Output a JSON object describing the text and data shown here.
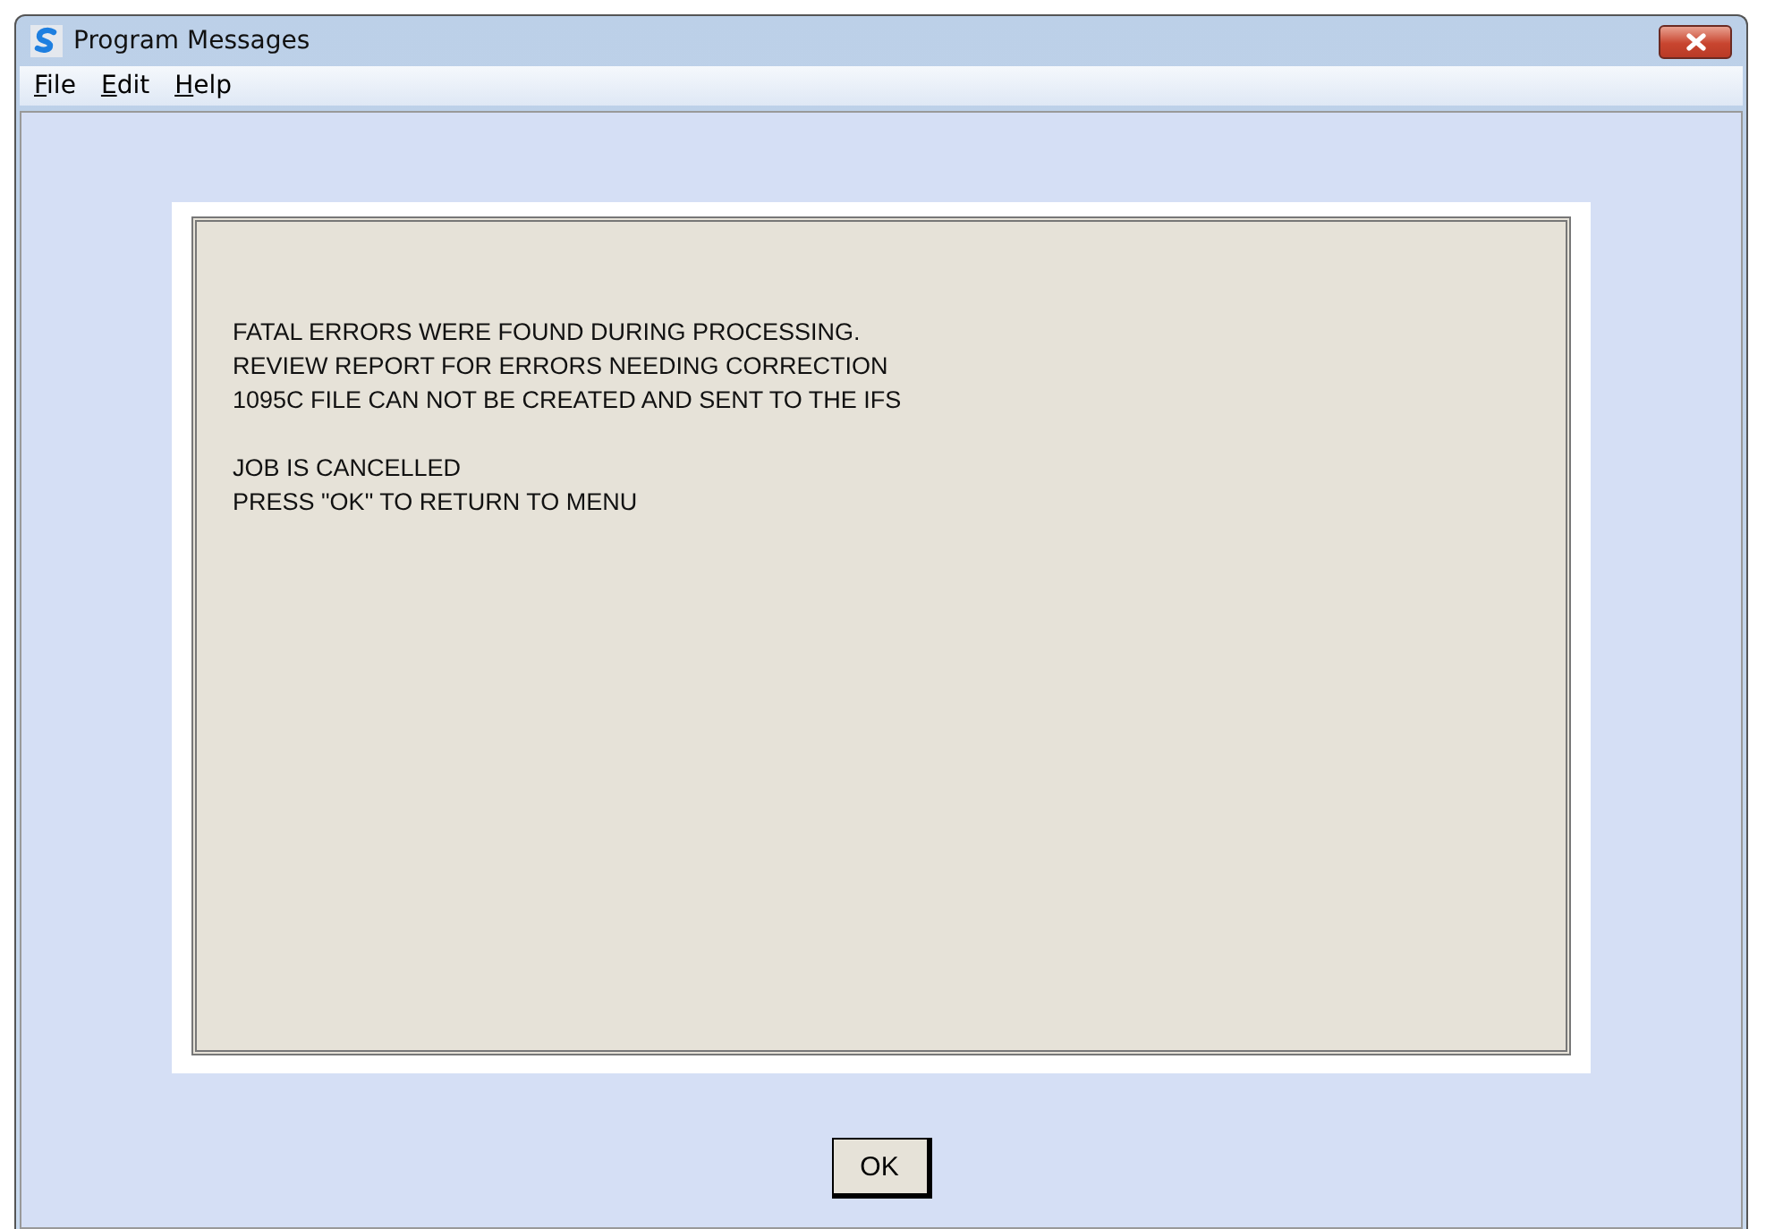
{
  "window": {
    "title": "Program Messages"
  },
  "menu": [
    "File",
    "Edit",
    "Help"
  ],
  "message": {
    "paragraphs": [
      [
        "FATAL ERRORS WERE FOUND DURING PROCESSING.",
        "REVIEW REPORT FOR ERRORS NEEDING CORRECTION",
        "1095C FILE CAN NOT BE CREATED AND SENT TO THE IFS"
      ],
      [
        "JOB IS CANCELLED",
        "PRESS \"OK\" TO RETURN TO MENU"
      ]
    ]
  },
  "buttons": [
    "OK"
  ]
}
